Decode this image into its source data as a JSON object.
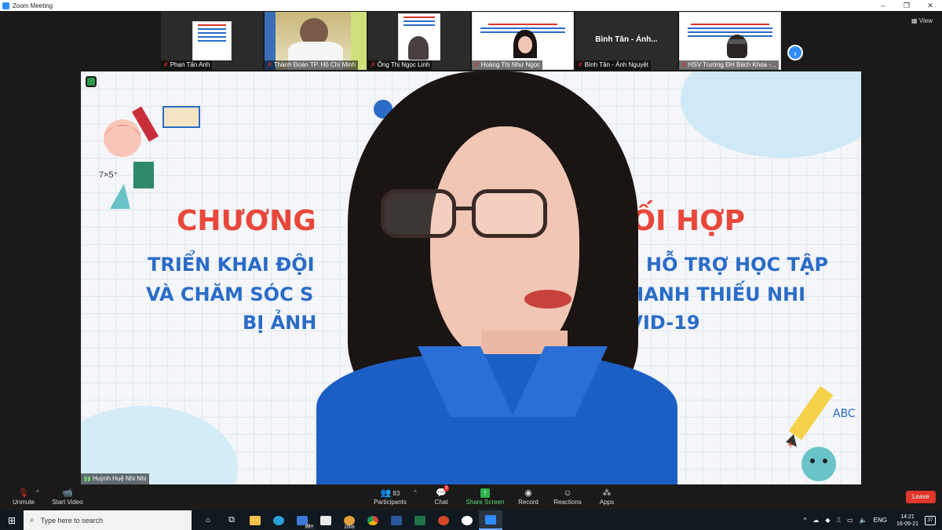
{
  "window": {
    "title": "Zoom Meeting",
    "controls": [
      "–",
      "❐",
      "✕"
    ]
  },
  "strip": {
    "view_label": "View",
    "participants": [
      {
        "name": "Phan Tấn Anh",
        "type": "slide"
      },
      {
        "name": "Thành Đoàn TP. Hồ Chí Minh",
        "type": "video"
      },
      {
        "name": "Ông Thị Ngọc Linh",
        "type": "video"
      },
      {
        "name": "Hoàng Thị Như Ngọc",
        "type": "slide-video"
      },
      {
        "name": "Bình Tân - Ánh Nguyệt",
        "center_label": "Bình Tân - Ánh...",
        "type": "name-only"
      },
      {
        "name": "HSV Trường ĐH Bách Khoa -...",
        "type": "slide-video"
      }
    ]
  },
  "main_slide": {
    "line1_a": "CHƯƠNG",
    "line1_b": "PHỐI HỢP",
    "line2_a": "TRIỂN KHAI ĐỘI",
    "line2_b": "HỖ TRỢ HỌC TẬP",
    "line3_a": "VÀ CHĂM SÓC S",
    "line3_b": "O THANH THIẾU NHI",
    "line4_a": "BỊ ẢNH",
    "line4_b": "COVID-19",
    "speaker_name": "Huỳnh Huệ Nhi Nhi"
  },
  "toolbar": {
    "unmute": "Unmute",
    "start_video": "Start Video",
    "participants": "Participants",
    "participants_count": "83",
    "chat": "Chat",
    "chat_badge": "3",
    "share_screen": "Share Screen",
    "record": "Record",
    "reactions": "Reactions",
    "apps": "Apps",
    "leave": "Leave"
  },
  "taskbar": {
    "search_placeholder": "Type here to search",
    "badge_mail": "99+",
    "badge_cal": "2006",
    "lang": "ENG",
    "time": "14:21",
    "date": "16-09-21",
    "notifications": "37"
  },
  "colors": {
    "accent": "#2d8cff",
    "leave": "#e0362b",
    "share": "#28b44a",
    "slide_red": "#e8473a",
    "slide_blue": "#2a6cc7"
  }
}
